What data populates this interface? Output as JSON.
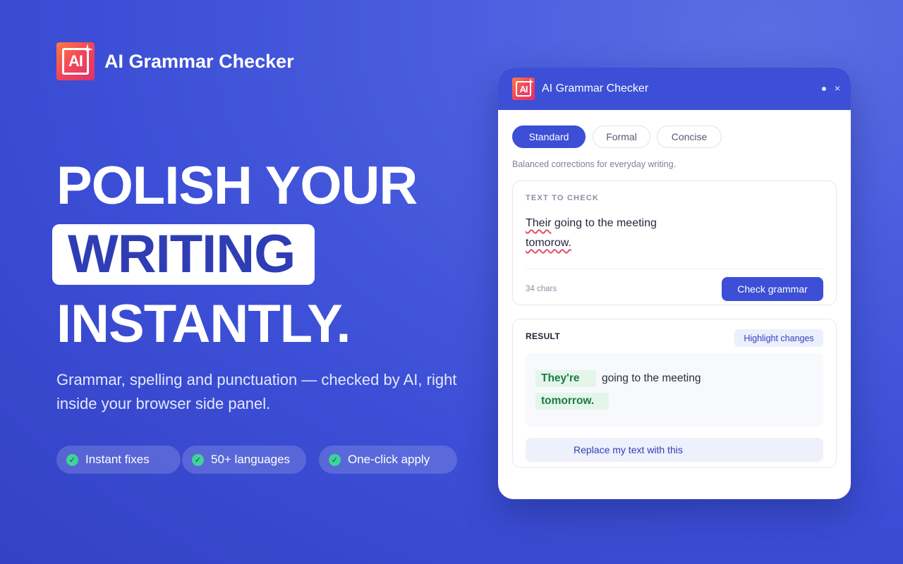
{
  "brand": {
    "name": "AI Grammar Checker",
    "icon_text": "AI",
    "colors": {
      "background": "#3c4fd6",
      "icon_gradient_start": "#ff7a3c",
      "icon_gradient_end": "#e0306b",
      "accent": "#3c4fd6",
      "success": "#3ed39a"
    }
  },
  "hero": {
    "line1": "POLISH YOUR",
    "line2": "WRITING",
    "line3": "INSTANTLY.",
    "subtitle": "Grammar, spelling and punctuation — checked by AI, right inside your browser side panel."
  },
  "features": [
    {
      "label": "Instant fixes",
      "icon": "check-circle-icon"
    },
    {
      "label": "50+ languages",
      "icon": "check-circle-icon"
    },
    {
      "label": "One-click apply",
      "icon": "check-circle-icon"
    }
  ],
  "panel": {
    "title": "AI Grammar Checker",
    "close": "×",
    "modes": [
      {
        "label": "Standard",
        "active": true
      },
      {
        "label": "Formal",
        "active": false
      },
      {
        "label": "Concise",
        "active": false
      }
    ],
    "mode_description": "Balanced corrections for everyday writing.",
    "input": {
      "label": "TEXT TO CHECK",
      "word_error1": "Their",
      "text_rest1": " going to the meeting",
      "word_error2": "tomorow.",
      "char_count": "34 chars",
      "button": "Check grammar"
    },
    "result": {
      "label": "RESULT",
      "highlight_button": "Highlight changes",
      "fix1": "They're",
      "plain1": "going to the meeting",
      "fix2": "tomorrow.",
      "replace_button": "Replace my text with this"
    }
  }
}
